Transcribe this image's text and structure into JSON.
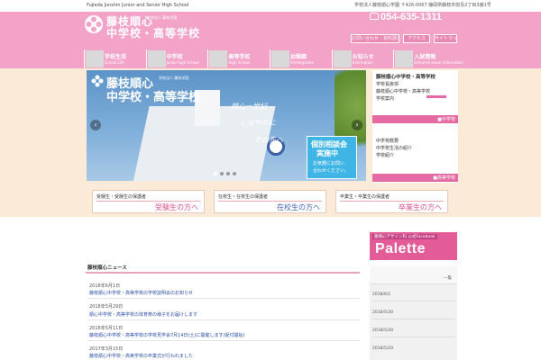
{
  "top": {
    "school_en": "Fujieda Junshin Junior and Senior High School",
    "address": "学校法人藤枝順心学園 〒426-0067 静岡県藤枝市前島2丁目3番1号"
  },
  "header": {
    "logo_name1": "藤枝順心",
    "logo_name2": "中学校・高等学校",
    "logo_corp": "学校法人 藤枝学園",
    "phone": "054-635-1311",
    "buttons": [
      "お問い合わせ・資料請求",
      "アクセス",
      "サイトマップ"
    ]
  },
  "gnav": [
    {
      "ja": "学校生活",
      "en": "School Life"
    },
    {
      "ja": "中学校",
      "en": "Junior high School"
    },
    {
      "ja": "高等学校",
      "en": "High School"
    },
    {
      "ja": "幼稚園",
      "en": "Kindergarten"
    },
    {
      "ja": "お知らせ",
      "en": "Information"
    },
    {
      "ja": "入試情報",
      "en": "Entrance exam information"
    }
  ],
  "slider": {
    "name1": "藤枝順心",
    "name2": "中学校・高等学校",
    "corp": "学校法人 藤枝学園",
    "tag1": "順心一世紀",
    "tag2": "しなやかに",
    "tag3": "その先へ",
    "consult1": "個別相談会",
    "consult2": "実施中",
    "consult3": "お気軽にお問い",
    "consult4": "合わせください。",
    "prev": "‹",
    "next": "›"
  },
  "sidebar": {
    "title": "藤枝順心中学校・高等学校",
    "links1": [
      "学校長挨拶",
      "藤枝順心中学校・高等学校",
      "学校案内"
    ],
    "sect1": "■中学校",
    "links2": [
      "中学校概要",
      "中学校生活の紹介",
      "学校紹介"
    ],
    "sect2": "■高等学校"
  },
  "portals": [
    {
      "title": "受験生・受験生の保護者",
      "link": "受験生の方へ",
      "color": "#d9508e"
    },
    {
      "title": "在校生・在校生の保護者",
      "link": "在校生の方へ",
      "color": "#3f64b8"
    },
    {
      "title": "卒業生・卒業生の保護者",
      "link": "卒業生の方へ",
      "color": "#d9508e"
    }
  ],
  "banner": {
    "line1": "藤順心デザイン科 公式Facebook",
    "line2": "Palette"
  },
  "news": {
    "title": "藤枝順心ニュース",
    "items": [
      {
        "date": "2018年6月1日",
        "text": "藤枝順心中学校・高等学校の学校説明会のお知らせ"
      },
      {
        "date": "2018年5月29日",
        "text": "順心中学校・高等学校の体育祭の様子をお届けします"
      },
      {
        "date": "2018年5月11日",
        "text": "藤枝順心中学校・高等学校の学校見学会7月14日(土)に開催します(受付開始)"
      },
      {
        "date": "2017年3月15日",
        "text": "藤枝順心中学校・高等学校の卒業式が行われました"
      }
    ]
  },
  "sidecol": {
    "more": "一覧",
    "dates": [
      "2018/6/1",
      "2018/5/30",
      "2018/5/30",
      "2018/5/29"
    ]
  }
}
